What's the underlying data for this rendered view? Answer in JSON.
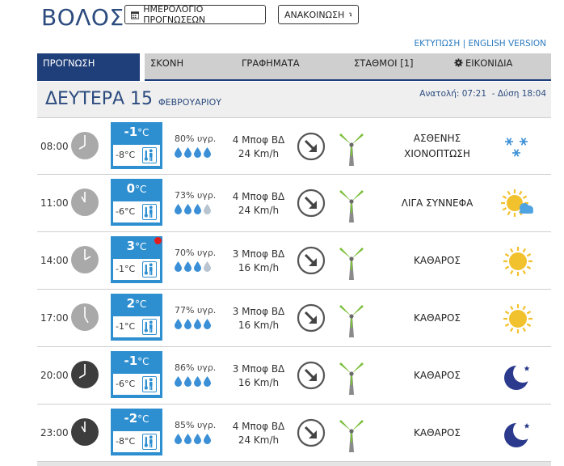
{
  "header": {
    "city": "ΒΟΛΟΣ",
    "calendar_button": "ΗΜΕΡΟΛΟΓΙΟ ΠΡΟΓΝΩΣΕΩΝ",
    "refresh_button": "ΑΝΑΚΟΙΝΩΣΗ",
    "print_link": "ΕΚΤΥΠΩΣΗ",
    "separator": "|",
    "english_link": "ENGLISH VERSION"
  },
  "tabs": [
    {
      "label": "ΠΡΟΓΝΩΣΗ"
    },
    {
      "label": "ΣΚΟΝΗ"
    },
    {
      "label": "ΓΡΑΦΗΜΑΤΑ"
    },
    {
      "label": "ΣΤΑΘΜΟΙ  [1]"
    },
    {
      "label": "ΕΙΚΟΝΙΔΙΑ"
    }
  ],
  "day": {
    "name": "ΔΕΥΤΕΡΑ 15",
    "month": "ΦΕΒΡΟΥΑΡΙΟΥ",
    "sunrise_label": "Ανατολή: 07:21",
    "sunset_label": "- Δύση 18:04"
  },
  "unit": "°C",
  "rows": [
    {
      "time": "08:00",
      "temp": "-1",
      "feel": "-8°C",
      "humidity": "80% υγρ.",
      "wind_bf": "4 Μποφ ΒΔ",
      "wind_kmh": "24 Km/h",
      "cond1": "ΑΣΘΕΝΗΣ",
      "cond2": "ΧΙΟΝΟΠΤΩΣΗ",
      "icon": "snow-icon",
      "night": false,
      "alert": false,
      "drops_full": 4
    },
    {
      "time": "11:00",
      "temp": "0",
      "feel": "-6°C",
      "humidity": "73% υγρ.",
      "wind_bf": "4 Μποφ ΒΔ",
      "wind_kmh": "24 Km/h",
      "cond1": "ΛΙΓΑ ΣΥΝΝΕΦΑ",
      "cond2": "",
      "icon": "partly-cloudy-icon",
      "night": false,
      "alert": false,
      "drops_full": 3
    },
    {
      "time": "14:00",
      "temp": "3",
      "feel": "-1°C",
      "humidity": "70% υγρ.",
      "wind_bf": "3 Μποφ ΒΔ",
      "wind_kmh": "16 Km/h",
      "cond1": "ΚΑΘΑΡΟΣ",
      "cond2": "",
      "icon": "sun-icon",
      "night": false,
      "alert": true,
      "drops_full": 3
    },
    {
      "time": "17:00",
      "temp": "2",
      "feel": "-1°C",
      "humidity": "77% υγρ.",
      "wind_bf": "3 Μποφ ΒΔ",
      "wind_kmh": "16 Km/h",
      "cond1": "ΚΑΘΑΡΟΣ",
      "cond2": "",
      "icon": "sun-icon",
      "night": false,
      "alert": false,
      "drops_full": 4
    },
    {
      "time": "20:00",
      "temp": "-1",
      "feel": "-6°C",
      "humidity": "86% υγρ.",
      "wind_bf": "3 Μποφ ΒΔ",
      "wind_kmh": "16 Km/h",
      "cond1": "ΚΑΘΑΡΟΣ",
      "cond2": "",
      "icon": "moon-icon",
      "night": true,
      "alert": false,
      "drops_full": 4
    },
    {
      "time": "23:00",
      "temp": "-2",
      "feel": "-8°C",
      "humidity": "85% υγρ.",
      "wind_bf": "4 Μποφ ΒΔ",
      "wind_kmh": "24 Km/h",
      "cond1": "ΚΑΘΑΡΟΣ",
      "cond2": "",
      "icon": "moon-icon",
      "night": true,
      "alert": false,
      "drops_full": 4
    }
  ],
  "colors": {
    "title_blue": "#2b4a7e",
    "temp_blue": "#2e8fd0",
    "drop_full": "#3a8fd6",
    "drop_empty": "#b8c4cf",
    "turbine_green": "#7bbf3a",
    "sun_yellow": "#f2c12e",
    "moon_navy": "#2b3a8c",
    "alert_red": "#e21c1c"
  }
}
